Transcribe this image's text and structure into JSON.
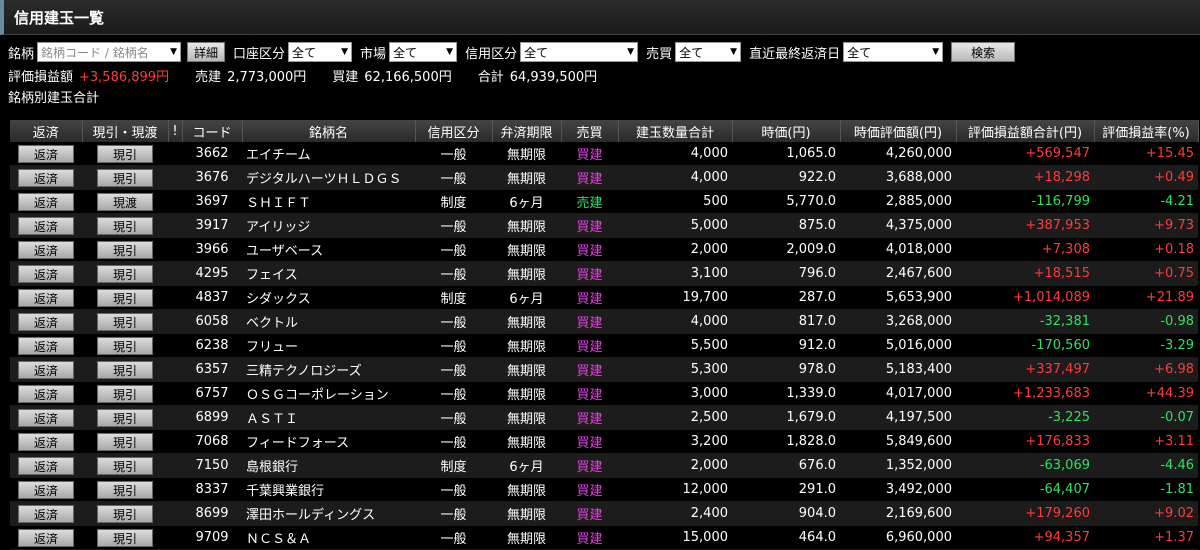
{
  "title": "信用建玉一覧",
  "filters": {
    "meigara_label": "銘柄",
    "meigara_placeholder": "銘柄コード / 銘柄名",
    "detail_button": "詳細",
    "account_label": "口座区分",
    "account_value": "全て",
    "market_label": "市場",
    "market_value": "全て",
    "credit_label": "信用区分",
    "credit_value": "全て",
    "trade_label": "売買",
    "trade_value": "全て",
    "due_label": "直近最終返済日",
    "due_value": "全て",
    "search_button": "検索"
  },
  "summary": {
    "pl_label": "評価損益額",
    "pl_value": "+3,586,899円",
    "sell_label": "売建",
    "sell_value": "2,773,000円",
    "buy_label": "買建",
    "buy_value": "62,166,500円",
    "total_label": "合計",
    "total_value": "64,939,500円"
  },
  "section_title": "銘柄別建玉合計",
  "columns": [
    "返済",
    "現引・現渡",
    "!",
    "コード",
    "銘柄名",
    "信用区分",
    "弁済期限",
    "売買",
    "建玉数量合計",
    "時価(円)",
    "時価評価額(円)",
    "評価損益額合計(円)",
    "評価損益率(%)"
  ],
  "repay_label": "返済",
  "rows": [
    {
      "action": "現引",
      "code": "3662",
      "name": "エイチーム",
      "credit": "一般",
      "due": "無期限",
      "side": "買建",
      "qty": "4,000",
      "price": "1,065.0",
      "value": "4,260,000",
      "pl": "+569,547",
      "rate": "+15.45"
    },
    {
      "action": "現引",
      "code": "3676",
      "name": "デジタルハーツＨＬＤＧＳ",
      "credit": "一般",
      "due": "無期限",
      "side": "買建",
      "qty": "4,000",
      "price": "922.0",
      "value": "3,688,000",
      "pl": "+18,298",
      "rate": "+0.49"
    },
    {
      "action": "現渡",
      "code": "3697",
      "name": "ＳＨＩＦＴ",
      "credit": "制度",
      "due": "6ヶ月",
      "side": "売建",
      "qty": "500",
      "price": "5,770.0",
      "value": "2,885,000",
      "pl": "-116,799",
      "rate": "-4.21"
    },
    {
      "action": "現引",
      "code": "3917",
      "name": "アイリッジ",
      "credit": "一般",
      "due": "無期限",
      "side": "買建",
      "qty": "5,000",
      "price": "875.0",
      "value": "4,375,000",
      "pl": "+387,953",
      "rate": "+9.73"
    },
    {
      "action": "現引",
      "code": "3966",
      "name": "ユーザベース",
      "credit": "一般",
      "due": "無期限",
      "side": "買建",
      "qty": "2,000",
      "price": "2,009.0",
      "value": "4,018,000",
      "pl": "+7,308",
      "rate": "+0.18"
    },
    {
      "action": "現引",
      "code": "4295",
      "name": "フェイス",
      "credit": "一般",
      "due": "無期限",
      "side": "買建",
      "qty": "3,100",
      "price": "796.0",
      "value": "2,467,600",
      "pl": "+18,515",
      "rate": "+0.75"
    },
    {
      "action": "現引",
      "code": "4837",
      "name": "シダックス",
      "credit": "制度",
      "due": "6ヶ月",
      "side": "買建",
      "qty": "19,700",
      "price": "287.0",
      "value": "5,653,900",
      "pl": "+1,014,089",
      "rate": "+21.89"
    },
    {
      "action": "現引",
      "code": "6058",
      "name": "ベクトル",
      "credit": "一般",
      "due": "無期限",
      "side": "買建",
      "qty": "4,000",
      "price": "817.0",
      "value": "3,268,000",
      "pl": "-32,381",
      "rate": "-0.98"
    },
    {
      "action": "現引",
      "code": "6238",
      "name": "フリュー",
      "credit": "一般",
      "due": "無期限",
      "side": "買建",
      "qty": "5,500",
      "price": "912.0",
      "value": "5,016,000",
      "pl": "-170,560",
      "rate": "-3.29"
    },
    {
      "action": "現引",
      "code": "6357",
      "name": "三精テクノロジーズ",
      "credit": "一般",
      "due": "無期限",
      "side": "買建",
      "qty": "5,300",
      "price": "978.0",
      "value": "5,183,400",
      "pl": "+337,497",
      "rate": "+6.98"
    },
    {
      "action": "現引",
      "code": "6757",
      "name": "ＯＳＧコーポレーション",
      "credit": "一般",
      "due": "無期限",
      "side": "買建",
      "qty": "3,000",
      "price": "1,339.0",
      "value": "4,017,000",
      "pl": "+1,233,683",
      "rate": "+44.39"
    },
    {
      "action": "現引",
      "code": "6899",
      "name": "ＡＳＴＩ",
      "credit": "一般",
      "due": "無期限",
      "side": "買建",
      "qty": "2,500",
      "price": "1,679.0",
      "value": "4,197,500",
      "pl": "-3,225",
      "rate": "-0.07"
    },
    {
      "action": "現引",
      "code": "7068",
      "name": "フィードフォース",
      "credit": "一般",
      "due": "無期限",
      "side": "買建",
      "qty": "3,200",
      "price": "1,828.0",
      "value": "5,849,600",
      "pl": "+176,833",
      "rate": "+3.11"
    },
    {
      "action": "現引",
      "code": "7150",
      "name": "島根銀行",
      "credit": "制度",
      "due": "6ヶ月",
      "side": "買建",
      "qty": "2,000",
      "price": "676.0",
      "value": "1,352,000",
      "pl": "-63,069",
      "rate": "-4.46"
    },
    {
      "action": "現引",
      "code": "8337",
      "name": "千葉興業銀行",
      "credit": "一般",
      "due": "無期限",
      "side": "買建",
      "qty": "12,000",
      "price": "291.0",
      "value": "3,492,000",
      "pl": "-64,407",
      "rate": "-1.81"
    },
    {
      "action": "現引",
      "code": "8699",
      "name": "澤田ホールディングス",
      "credit": "一般",
      "due": "無期限",
      "side": "買建",
      "qty": "2,400",
      "price": "904.0",
      "value": "2,169,600",
      "pl": "+179,260",
      "rate": "+9.02"
    },
    {
      "action": "現引",
      "code": "9709",
      "name": "ＮＣＳ＆Ａ",
      "credit": "一般",
      "due": "無期限",
      "side": "買建",
      "qty": "15,000",
      "price": "464.0",
      "value": "6,960,000",
      "pl": "+94,357",
      "rate": "+1.37"
    }
  ]
}
